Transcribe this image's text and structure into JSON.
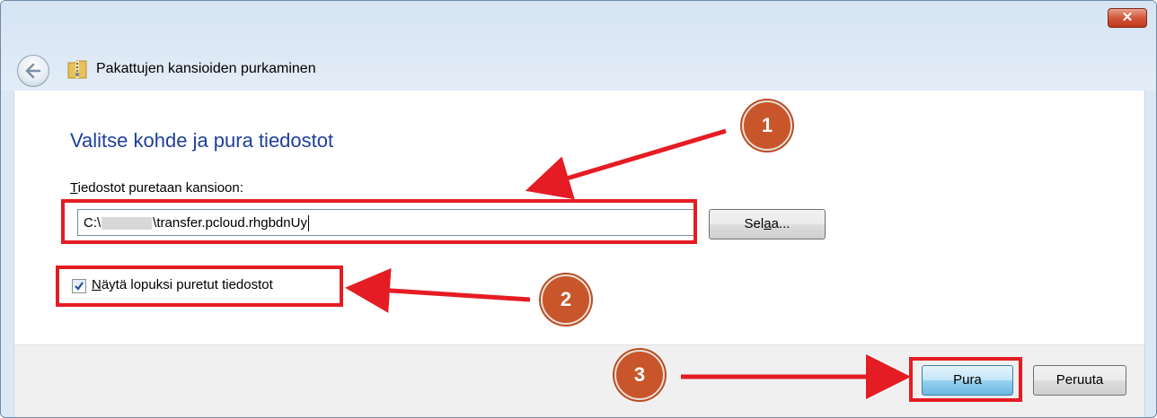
{
  "window": {
    "title": "Pakattujen kansioiden purkaminen",
    "close_label": "✕"
  },
  "content": {
    "heading": "Valitse kohde ja pura tiedostot",
    "dest_label_first": "T",
    "dest_label_rest": "iedostot puretaan kansioon:",
    "path_prefix": "C:\\",
    "path_suffix": "\\transfer.pcloud.rhgbdnUy",
    "browse_label_a": "Sel",
    "browse_label_b": "a",
    "browse_label_c": "a...",
    "checkbox_checked": true,
    "checkbox_label_first": "N",
    "checkbox_label_rest": "äytä lopuksi puretut tiedostot"
  },
  "footer": {
    "extract_label": "Pura",
    "cancel_label": "Peruuta"
  },
  "annotations": {
    "badge_1": "1",
    "badge_2": "2",
    "badge_3": "3",
    "highlight_color": "#e51c23",
    "badge_color": "#c9562a"
  }
}
